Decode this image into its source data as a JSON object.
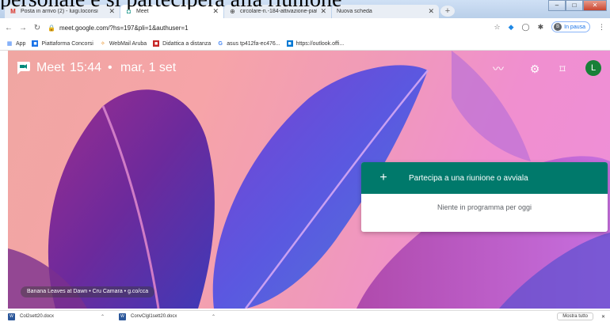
{
  "overlay_caption": "personale e si parteciperà alla riunione",
  "tabs": [
    {
      "title": "Posta in arrivo (2) - luigi.loconsi",
      "icon": "gmail-icon"
    },
    {
      "title": "Meet",
      "icon": "meet-icon"
    },
    {
      "title": "circolare-n.-184-attivazione-piat",
      "icon": "globe-icon"
    },
    {
      "title": "Nuova scheda",
      "icon": ""
    }
  ],
  "address": {
    "url": "meet.google.com/?hs=197&pli=1&authuser=1"
  },
  "profile": {
    "initial": "B",
    "label": "In pausa"
  },
  "bookmarks": [
    {
      "label": "App",
      "icon": "apps-grid-icon"
    },
    {
      "label": "Piattaforma Concorsi",
      "icon": "bookmark-icon"
    },
    {
      "label": "WebMail Aruba",
      "icon": "webmail-icon"
    },
    {
      "label": "Didattica a distanza",
      "icon": "didattica-icon"
    },
    {
      "label": "asus tp412fa-ec476...",
      "icon": "google-icon"
    },
    {
      "label": "https://outlook.offi...",
      "icon": "outlook-icon"
    }
  ],
  "meet": {
    "title": "Meet",
    "time": "15:44",
    "separator": "•",
    "date": "mar, 1 set",
    "avatar_initial": "L",
    "join_label": "Partecipa a una riunione o avviala",
    "empty_message": "Niente in programma per oggi",
    "photo_credit": "Banana Leaves at Dawn • Cru Camara • g.co/cca"
  },
  "downloads": {
    "items": [
      {
        "name": "Col2sett20.docx"
      },
      {
        "name": "ConvClgl1sett20.docx"
      }
    ],
    "show_all": "Mostra tutto",
    "close": "✕"
  },
  "colors": {
    "meet_green": "#00796b",
    "avatar_green": "#188038"
  }
}
